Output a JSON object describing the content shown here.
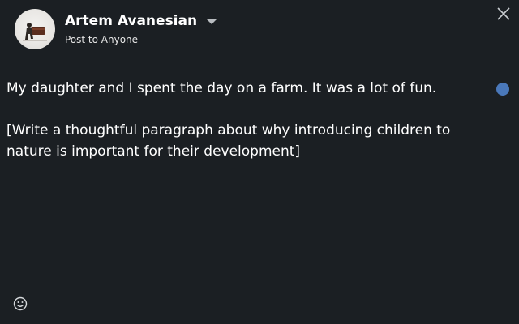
{
  "header": {
    "author_name": "Artem Avanesian",
    "visibility": "Post to Anyone"
  },
  "editor": {
    "line1": "My daughter and I spent the day on a farm. It was a lot of fun.",
    "line2": "[Write a thoughtful paragraph about why introducing children to nature is important for their development]"
  },
  "colors": {
    "background": "#1b1f23",
    "text": "#ffffff",
    "indicator": "#4a78ba"
  },
  "icons": {
    "close": "close-icon",
    "dropdown": "chevron-down-icon",
    "emoji": "emoji-icon"
  }
}
